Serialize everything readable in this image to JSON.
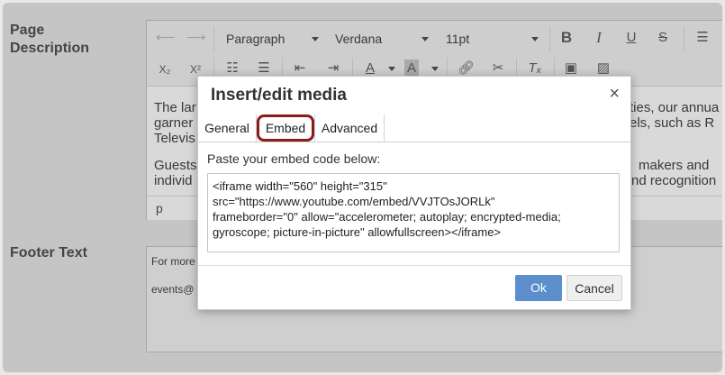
{
  "labels": {
    "page_description_line1": "Page",
    "page_description_line2": "Description",
    "footer_text": "Footer Text"
  },
  "toolbar": {
    "block_format": "Paragraph",
    "font_family": "Verdana",
    "font_size": "11pt",
    "bold_icon": "B",
    "italic_icon": "I",
    "underline_icon": "U",
    "strike_icon": "S",
    "subscript_icon": "X₂",
    "superscript_icon": "X²",
    "text_color_icon": "A",
    "bg_color_icon": "A",
    "clear_format_icon": "Tₓ"
  },
  "editor": {
    "line1_left": "The lar",
    "line1_right": "ties, our annua",
    "line2_left": "garner",
    "line2_right": "els, such as R",
    "line3_left": "Televis",
    "line4_left": "Guests",
    "line4_right": "makers and",
    "line5_left": "individ",
    "line5_right": "nd recognition",
    "status_path": "p"
  },
  "footer": {
    "line1": "For more",
    "line2": "events@"
  },
  "dialog": {
    "title": "Insert/edit media",
    "close": "×",
    "tabs": [
      "General",
      "Embed",
      "Advanced"
    ],
    "active_tab": "Embed",
    "prompt": "Paste your embed code below:",
    "embed_code": "<iframe width=\"560\" height=\"315\"\nsrc=\"https://www.youtube.com/embed/VVJTOsJORLk\"\nframeborder=\"0\" allow=\"accelerometer; autoplay; encrypted-media;\ngyroscope; picture-in-picture\" allowfullscreen></iframe>",
    "ok_label": "Ok",
    "cancel_label": "Cancel"
  },
  "colors": {
    "ok_button": "#5c8ecb",
    "highlight_ring": "#8b1a1a"
  }
}
